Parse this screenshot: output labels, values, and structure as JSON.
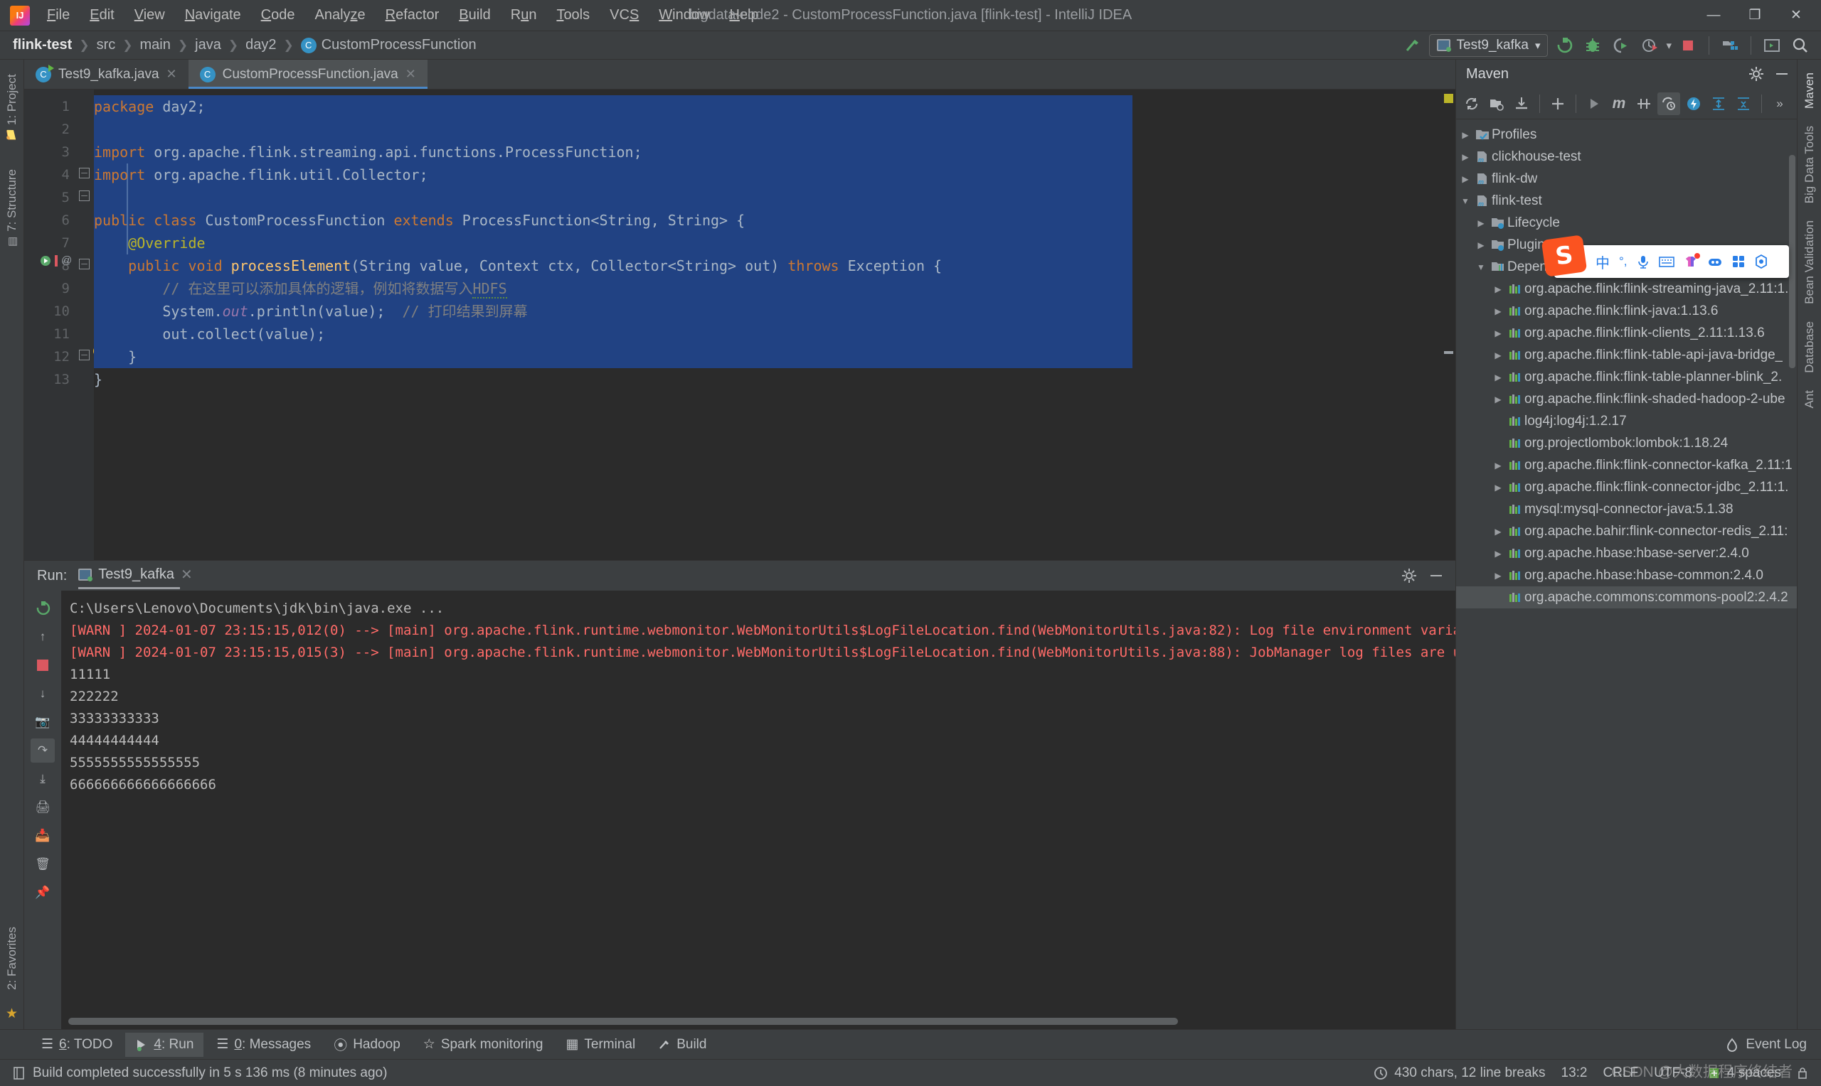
{
  "window": {
    "title": "bigdata-code2 - CustomProcessFunction.java [flink-test] - IntelliJ IDEA",
    "minimize": "—",
    "maximize": "❐",
    "close": "✕"
  },
  "menubar": {
    "items": [
      {
        "label": "File",
        "mnemonic": "F"
      },
      {
        "label": "Edit",
        "mnemonic": "E"
      },
      {
        "label": "View",
        "mnemonic": "V"
      },
      {
        "label": "Navigate",
        "mnemonic": "N"
      },
      {
        "label": "Code",
        "mnemonic": "C"
      },
      {
        "label": "Analyze",
        "mnemonic": "z"
      },
      {
        "label": "Refactor",
        "mnemonic": "R"
      },
      {
        "label": "Build",
        "mnemonic": "B"
      },
      {
        "label": "Run",
        "mnemonic": "u"
      },
      {
        "label": "Tools",
        "mnemonic": "T"
      },
      {
        "label": "VCS",
        "mnemonic": "S"
      },
      {
        "label": "Window",
        "mnemonic": "W"
      },
      {
        "label": "Help",
        "mnemonic": "H"
      }
    ]
  },
  "breadcrumb": {
    "items": [
      "flink-test",
      "src",
      "main",
      "java",
      "day2",
      "CustomProcessFunction"
    ],
    "separator": "❯",
    "class_badge": "C"
  },
  "toolbar": {
    "run_configuration": "Test9_kafka",
    "dropdown_caret": "▾",
    "icons": [
      "build-hammer-icon",
      "run-icon",
      "debug-icon",
      "run-coverage-icon",
      "profiler-icon",
      "stop-icon",
      "project-structure-icon",
      "terminal-icon",
      "search-everywhere-icon"
    ]
  },
  "left_tool_strip": {
    "items": [
      "1: Project",
      "7: Structure",
      "2: Favorites"
    ]
  },
  "right_tool_strip": {
    "items": [
      "Maven",
      "Big Data Tools",
      "Bean Validation",
      "Database",
      "Ant"
    ]
  },
  "editor": {
    "tabs": [
      {
        "label": "Test9_kafka.java",
        "active": false,
        "close": "✕",
        "icon": "java-class-runnable-icon"
      },
      {
        "label": "CustomProcessFunction.java",
        "active": true,
        "close": "✕",
        "icon": "java-class-icon"
      }
    ],
    "line_numbers": [
      "1",
      "2",
      "3",
      "4",
      "5",
      "6",
      "7",
      "8",
      "9",
      "10",
      "11",
      "12",
      "13"
    ],
    "code_lines": [
      {
        "n": 1,
        "tokens": [
          {
            "t": "package",
            "c": "kw"
          },
          {
            "t": " day2;",
            "c": "pl"
          }
        ]
      },
      {
        "n": 2,
        "tokens": []
      },
      {
        "n": 3,
        "tokens": [
          {
            "t": "import",
            "c": "kw"
          },
          {
            "t": " org.apache.flink.streaming.api.functions.ProcessFunction;",
            "c": "pl"
          }
        ]
      },
      {
        "n": 4,
        "tokens": [
          {
            "t": "import",
            "c": "kw"
          },
          {
            "t": " org.apache.flink.util.Collector;",
            "c": "pl"
          }
        ]
      },
      {
        "n": 5,
        "tokens": []
      },
      {
        "n": 6,
        "tokens": [
          {
            "t": "public class",
            "c": "kw"
          },
          {
            "t": " CustomProcessFunction ",
            "c": "pl"
          },
          {
            "t": "extends",
            "c": "kw"
          },
          {
            "t": " ProcessFunction<String, String> {",
            "c": "pl"
          }
        ]
      },
      {
        "n": 7,
        "tokens": [
          {
            "t": "    @Override",
            "c": "ann"
          }
        ]
      },
      {
        "n": 8,
        "tokens": [
          {
            "t": "    public void",
            "c": "kw"
          },
          {
            "t": " ",
            "c": "pl"
          },
          {
            "t": "processElement",
            "c": "fn"
          },
          {
            "t": "(String value, Context ctx, Collector<String> out) ",
            "c": "pl"
          },
          {
            "t": "throws",
            "c": "kw"
          },
          {
            "t": " Exception {",
            "c": "pl"
          }
        ]
      },
      {
        "n": 9,
        "tokens": [
          {
            "t": "        // 在这里可以添加具体的逻辑，例如将数据写入HDFS",
            "c": "cmt"
          }
        ]
      },
      {
        "n": 10,
        "tokens": [
          {
            "t": "        System.",
            "c": "pl"
          },
          {
            "t": "out",
            "c": "fld"
          },
          {
            "t": ".println(value);  ",
            "c": "pl"
          },
          {
            "t": "// 打印结果到屏幕",
            "c": "cmt"
          }
        ]
      },
      {
        "n": 11,
        "tokens": [
          {
            "t": "        out.collect(value);",
            "c": "pl"
          }
        ]
      },
      {
        "n": 12,
        "tokens": [
          {
            "t": "    }",
            "c": "pl"
          }
        ]
      },
      {
        "n": 13,
        "tokens": [
          {
            "t": "}",
            "c": "pl"
          }
        ]
      }
    ],
    "gutter_markers": {
      "line8_run": "run-method-icon",
      "line8_override": "@",
      "line12_bulb": "intention-bulb-icon"
    }
  },
  "maven": {
    "title": "Maven",
    "settings_icon": "gear-icon",
    "minimize_icon": "minimize-icon",
    "toolbar_icons": [
      "reload-all-projects-icon",
      "add-maven-project-icon",
      "download-sources-icon",
      "add-icon",
      "run-icon",
      "execute-maven-goal-icon",
      "toggle-offline-icon",
      "toggle-skip-tests-icon",
      "show-dependencies-icon",
      "expand-all-icon",
      "collapse-all-icon",
      "more-icon"
    ],
    "tree": [
      {
        "label": "Profiles",
        "depth": 0,
        "arrow": "▶",
        "icon": "profiles-icon"
      },
      {
        "label": "clickhouse-test",
        "depth": 0,
        "arrow": "▶",
        "icon": "maven-module-icon"
      },
      {
        "label": "flink-dw",
        "depth": 0,
        "arrow": "▶",
        "icon": "maven-module-icon"
      },
      {
        "label": "flink-test",
        "depth": 0,
        "arrow": "▼",
        "icon": "maven-module-icon"
      },
      {
        "label": "Lifecycle",
        "depth": 1,
        "arrow": "▶",
        "icon": "lifecycle-icon"
      },
      {
        "label": "Plugins",
        "depth": 1,
        "arrow": "▶",
        "icon": "plugins-icon"
      },
      {
        "label": "Dependencies",
        "depth": 1,
        "arrow": "▼",
        "icon": "dependencies-icon"
      },
      {
        "label": "org.apache.flink:flink-streaming-java_2.11:1.",
        "depth": 2,
        "arrow": "▶",
        "icon": "library-icon"
      },
      {
        "label": "org.apache.flink:flink-java:1.13.6",
        "depth": 2,
        "arrow": "▶",
        "icon": "library-icon"
      },
      {
        "label": "org.apache.flink:flink-clients_2.11:1.13.6",
        "depth": 2,
        "arrow": "▶",
        "icon": "library-icon"
      },
      {
        "label": "org.apache.flink:flink-table-api-java-bridge_",
        "depth": 2,
        "arrow": "▶",
        "icon": "library-icon"
      },
      {
        "label": "org.apache.flink:flink-table-planner-blink_2.",
        "depth": 2,
        "arrow": "▶",
        "icon": "library-icon"
      },
      {
        "label": "org.apache.flink:flink-shaded-hadoop-2-ube",
        "depth": 2,
        "arrow": "▶",
        "icon": "library-icon"
      },
      {
        "label": "log4j:log4j:1.2.17",
        "depth": 2,
        "arrow": "",
        "icon": "library-icon"
      },
      {
        "label": "org.projectlombok:lombok:1.18.24",
        "depth": 2,
        "arrow": "",
        "icon": "library-icon"
      },
      {
        "label": "org.apache.flink:flink-connector-kafka_2.11:1",
        "depth": 2,
        "arrow": "▶",
        "icon": "library-icon"
      },
      {
        "label": "org.apache.flink:flink-connector-jdbc_2.11:1.",
        "depth": 2,
        "arrow": "▶",
        "icon": "library-icon"
      },
      {
        "label": "mysql:mysql-connector-java:5.1.38",
        "depth": 2,
        "arrow": "",
        "icon": "library-icon"
      },
      {
        "label": "org.apache.bahir:flink-connector-redis_2.11:",
        "depth": 2,
        "arrow": "▶",
        "icon": "library-icon"
      },
      {
        "label": "org.apache.hbase:hbase-server:2.4.0",
        "depth": 2,
        "arrow": "▶",
        "icon": "library-icon"
      },
      {
        "label": "org.apache.hbase:hbase-common:2.4.0",
        "depth": 2,
        "arrow": "▶",
        "icon": "library-icon"
      },
      {
        "label": "org.apache.commons:commons-pool2:2.4.2",
        "depth": 2,
        "arrow": "",
        "icon": "library-icon"
      }
    ]
  },
  "run_tool_window": {
    "label": "Run:",
    "tab": "Test9_kafka",
    "tab_close": "✕",
    "settings_icon": "gear-icon",
    "minimize_icon": "minimize-icon",
    "side_icons": [
      "rerun-icon",
      "up-stack-icon",
      "camera-icon",
      "soft-wrap-icon",
      "stop-icon",
      "print-icon",
      "scroll-to-end-icon",
      "export-icon",
      "clear-all-icon",
      "pin-icon"
    ],
    "console_lines": [
      {
        "text": "C:\\Users\\Lenovo\\Documents\\jdk\\bin\\java.exe ...",
        "kind": "path"
      },
      {
        "text": "[WARN ] 2024-01-07 23:15:15,012(0) --> [main] org.apache.flink.runtime.webmonitor.WebMonitorUtils$LogFileLocation.find(WebMonitorUtils.java:82): Log file environment variable 'log.file' is not set.",
        "kind": "warn"
      },
      {
        "text": "[WARN ] 2024-01-07 23:15:15,015(3) --> [main] org.apache.flink.runtime.webmonitor.WebMonitorUtils$LogFileLocation.find(WebMonitorUtils.java:88): JobManager log files are unavailable in the web dashbo",
        "kind": "warn"
      },
      {
        "text": "11111",
        "kind": "out"
      },
      {
        "text": "222222",
        "kind": "out"
      },
      {
        "text": "33333333333",
        "kind": "out"
      },
      {
        "text": "44444444444",
        "kind": "out"
      },
      {
        "text": "5555555555555555",
        "kind": "out"
      },
      {
        "text": "666666666666666666",
        "kind": "out"
      }
    ]
  },
  "bottom_tabs": {
    "items": [
      {
        "num": "6",
        "label": "TODO",
        "icon": "todo-icon",
        "active": false
      },
      {
        "num": "4",
        "label": "Run",
        "icon": "run-icon",
        "active": true
      },
      {
        "num": "0",
        "label": "Messages",
        "icon": "messages-icon",
        "active": false
      },
      {
        "num": "",
        "label": "Hadoop",
        "icon": "hadoop-icon",
        "active": false
      },
      {
        "num": "",
        "label": "Spark monitoring",
        "icon": "spark-icon",
        "active": false
      },
      {
        "num": "",
        "label": "Terminal",
        "icon": "terminal-icon",
        "active": false
      },
      {
        "num": "",
        "label": "Build",
        "icon": "build-icon",
        "active": false
      }
    ],
    "event_log": "Event Log",
    "event_log_icon": "event-log-icon"
  },
  "statusbar": {
    "message": "Build completed successfully in 5 s 136 ms (8 minutes ago)",
    "message_icon": "build-status-icon",
    "chars": "430 chars, 12 line breaks",
    "caret": "13:2",
    "line_separator": "CRLF",
    "encoding": "UTF-8",
    "indent": "4 spaces",
    "git_branch_icon": "git-branch-icon",
    "lock_icon": "lock-icon",
    "inspection_icon": "inspection-icon"
  },
  "ime_toolbar": {
    "logo": "S",
    "icons": [
      "chinese-mode-icon",
      "punctuation-icon",
      "microphone-icon",
      "keyboard-icon",
      "skin-icon",
      "toolbox-icon",
      "apps-icon",
      "settings-icon"
    ],
    "glyphs": [
      "中",
      "°,",
      "Ἲ4",
      "⌨",
      "ὅ5",
      "⚙",
      "■■",
      "❇"
    ]
  },
  "watermark": "CSDN @大数据程序终结者",
  "colors": {
    "accent": "#3592c4",
    "selection": "#214283",
    "error": "#ff6b68",
    "keyword": "#cc7832",
    "success": "#59a869",
    "panel": "#3c3f41",
    "editor_bg": "#2b2b2b"
  }
}
